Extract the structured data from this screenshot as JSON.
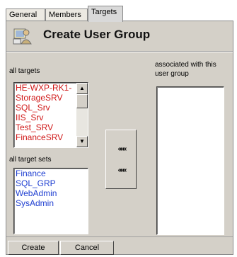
{
  "tabs": [
    {
      "label": "General",
      "active": false
    },
    {
      "label": "Members",
      "active": false
    },
    {
      "label": "Targets",
      "active": true
    }
  ],
  "header": {
    "title": "Create User Group",
    "icon": "user-group-icon"
  },
  "all_targets": {
    "label": "all targets",
    "items": [
      "HE-WXP-RK1-",
      "StorageSRV",
      "SQL_Srv",
      "IIS_Srv",
      "Test_SRV",
      "FinanceSRV"
    ],
    "scroll_up_icon": "▲",
    "scroll_down_icon": "▼"
  },
  "all_target_sets": {
    "label": "all target sets",
    "items": [
      "Finance",
      "SQL_GRP",
      "WebAdmin",
      "SysAdmin"
    ]
  },
  "associated": {
    "label_line1": "associated with this",
    "label_line2": "user group",
    "items": []
  },
  "move_buttons": {
    "add": "«««",
    "remove": "«««"
  },
  "buttons": {
    "create": "Create",
    "cancel": "Cancel"
  },
  "colors": {
    "target_items": "#d01818",
    "target_set_items": "#1f3fd1",
    "panel_bg": "#d4d0c8"
  }
}
